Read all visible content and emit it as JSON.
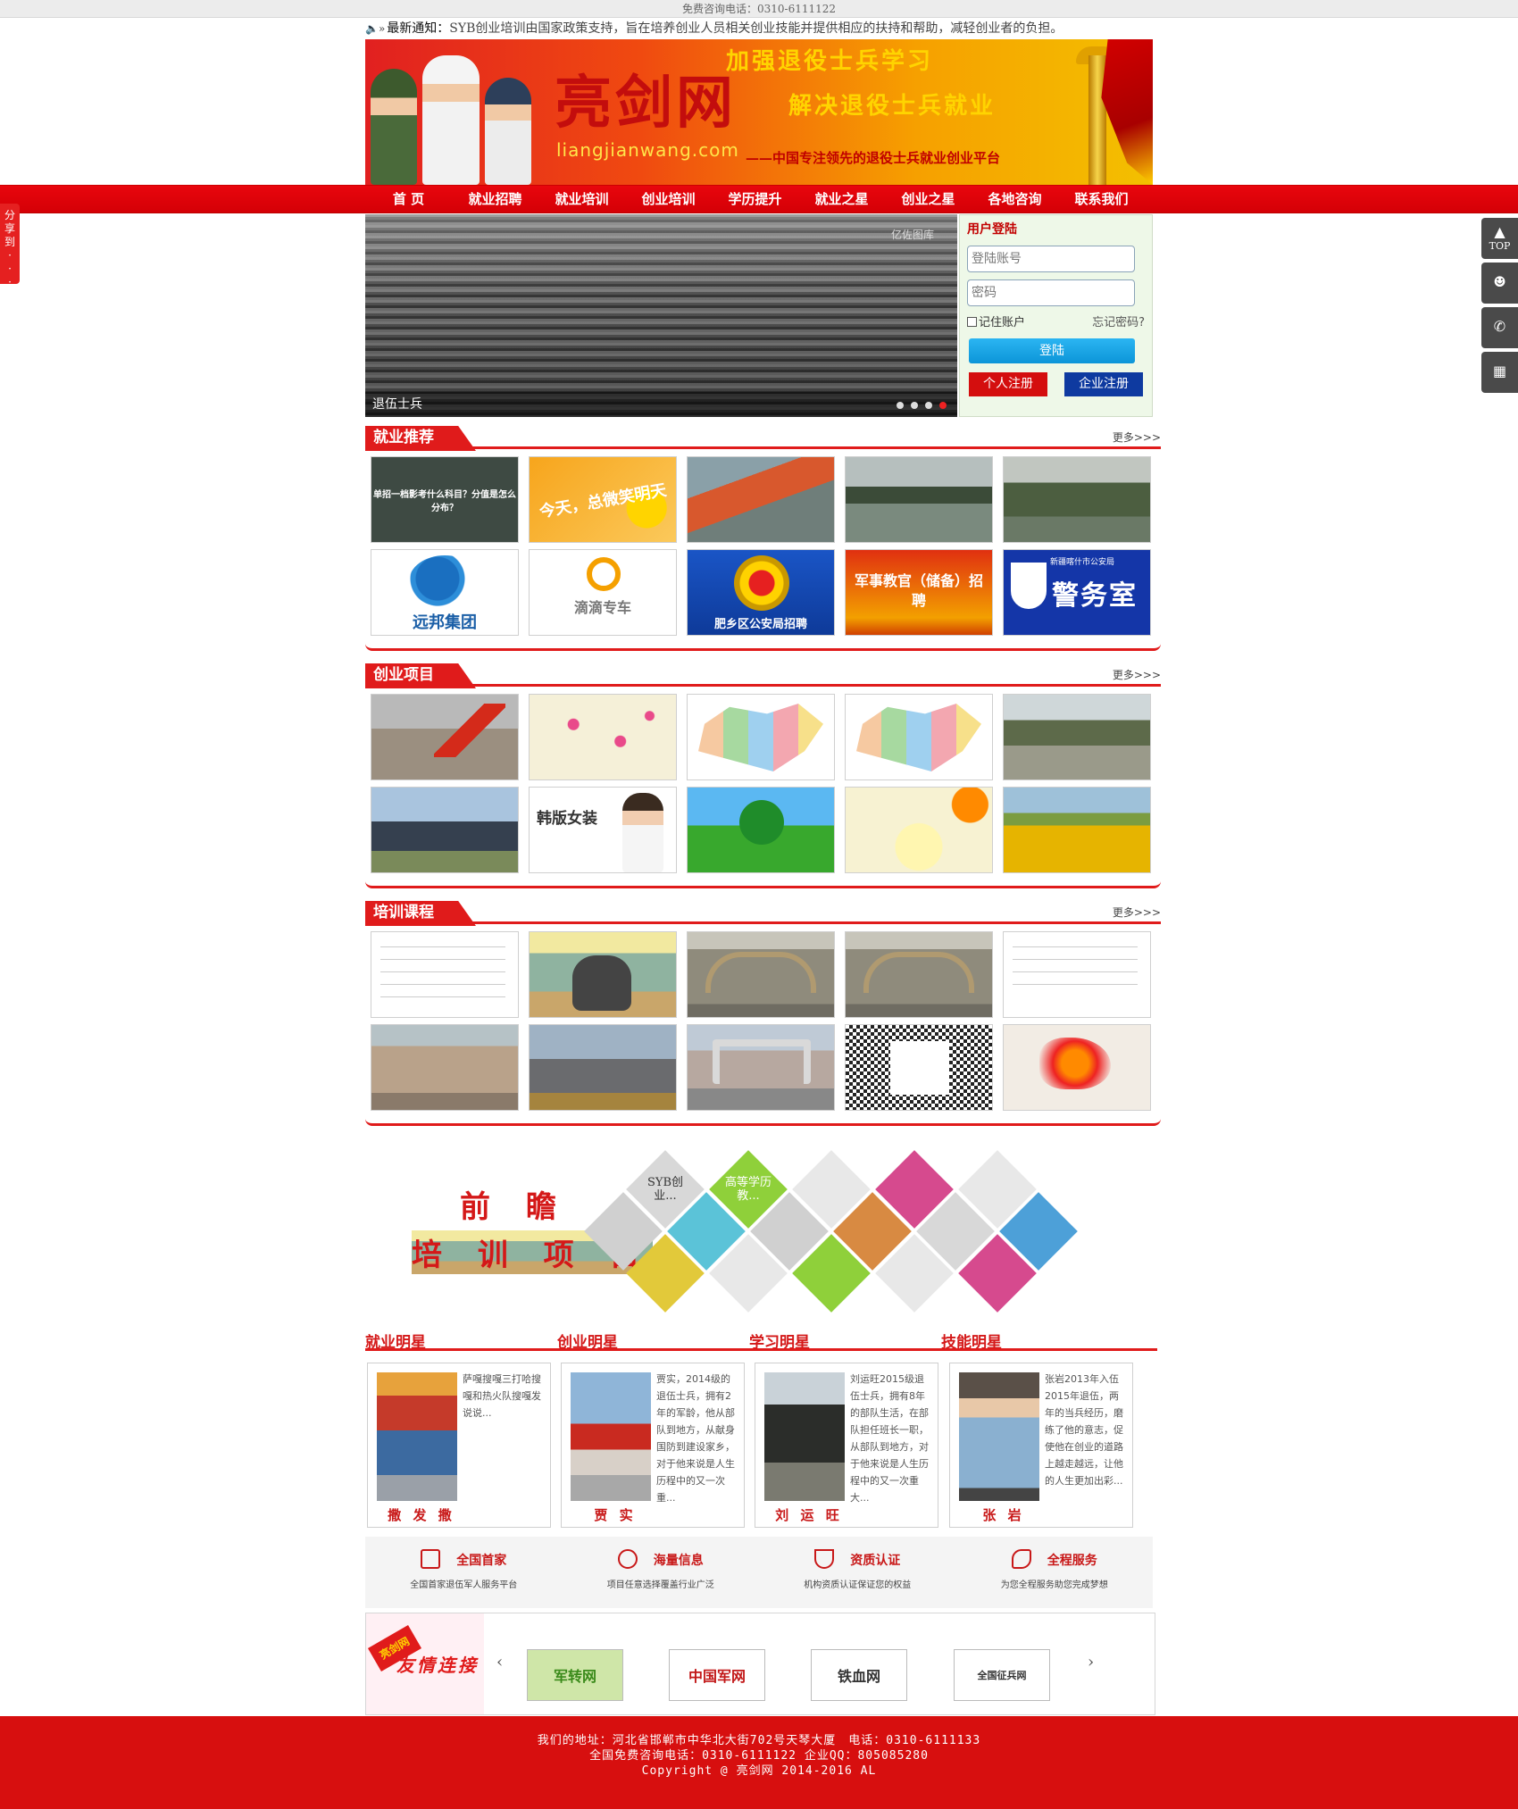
{
  "topbar": {
    "hotline": "免费咨询电话：0310-6111122"
  },
  "notice": {
    "label": "最新通知：",
    "text": "SYB创业培训由国家政策支持，旨在培养创业人员相关创业技能并提供相应的扶持和帮助，减轻创业者的负担。"
  },
  "banner": {
    "logo": "亮剑网",
    "logo_en": "liangjianwang.com",
    "slogan1": "加强退役士兵学习",
    "slogan2": "解决退役士兵就业",
    "slogan3": "——中国专注领先的退役士兵就业创业平台"
  },
  "nav": [
    "首 页",
    "就业招聘",
    "就业培训",
    "创业培训",
    "学历提升",
    "就业之星",
    "创业之星",
    "各地咨询",
    "联系我们"
  ],
  "share": {
    "label": [
      "分",
      "享",
      "到",
      "·",
      "·",
      "·"
    ]
  },
  "side_buttons": [
    {
      "icon": "arrow-up-icon",
      "glyph": "▲",
      "label": "TOP"
    },
    {
      "icon": "qq-icon",
      "glyph": "☻",
      "label": ""
    },
    {
      "icon": "phone-icon",
      "glyph": "✆",
      "label": ""
    },
    {
      "icon": "qrcode-icon",
      "glyph": "▦",
      "label": ""
    }
  ],
  "slider": {
    "caption": "退伍士兵",
    "watermark": "亿佐图库",
    "dots": 4,
    "active_dot": 4
  },
  "login": {
    "title": "用户登陆",
    "account_placeholder": "登陆账号",
    "password_placeholder": "密码",
    "remember": "记住账户",
    "forgot": "忘记密码?",
    "submit": "登陆",
    "personal_register": "个人注册",
    "company_register": "企业注册"
  },
  "sections": {
    "jobs": {
      "title": "就业推荐",
      "more": "更多>>>",
      "tiles": {
        "j1": "单招一档影考什么科目？分值是怎么分布？",
        "j2": "今天，总微笑明天",
        "j6": "远邦集团",
        "j7": "滴滴专车",
        "j8": "肥乡区公安局招聘",
        "j9": "军事教官（储备）招 聘",
        "j10": "警务室",
        "j10_top": "新疆喀什市公安局"
      }
    },
    "startup": {
      "title": "创业项目",
      "more": "更多>>>",
      "tiles": {
        "c7": "韩版女装"
      }
    },
    "training": {
      "title": "培训课程",
      "more": "更多>>>"
    }
  },
  "promo": {
    "line1": "前 瞻",
    "line2": "培 训 项 目",
    "diamond1": "SYB创业...",
    "diamond2": "高等学历教..."
  },
  "stars": {
    "headings": [
      "就业明星",
      "创业明星",
      "学习明星",
      "技能明星"
    ],
    "cards": [
      {
        "name": "撒 发 撒",
        "text": "萨嘎搜嘎三打哈搜嘎和热火队搜嘎发说说..."
      },
      {
        "name": "贾 实",
        "text": "贾实，2014级的退伍士兵，拥有2年的军龄，他从部队到地方，从献身国防到建设家乡，对于他来说是人生历程中的又一次重..."
      },
      {
        "name": "刘 运 旺",
        "text": "刘运旺2015级退伍士兵，拥有8年的部队生活，在部队担任班长一职，从部队到地方，对于他来说是人生历程中的又一次重大..."
      },
      {
        "name": "张 岩",
        "text": "张岩2013年入伍2015年退伍，两年的当兵经历，磨练了他的意志，促使他在创业的道路上越走越远，让他的人生更加出彩..."
      }
    ]
  },
  "features": [
    {
      "icon": "book-icon",
      "title": "全国首家",
      "desc": "全国首家退伍军人服务平台"
    },
    {
      "icon": "magnifier-icon",
      "title": "海量信息",
      "desc": "项目任意选择覆盖行业广泛"
    },
    {
      "icon": "shield-icon",
      "title": "资质认证",
      "desc": "机构资质认证保证您的权益"
    },
    {
      "icon": "service-icon",
      "title": "全程服务",
      "desc": "为您全程服务助您完成梦想"
    }
  ],
  "friend_links": {
    "stamp": "亮剑网",
    "title": "友情连接",
    "prev": "‹",
    "next": "›",
    "items": [
      "军转网",
      "中国军网",
      "铁血网",
      "全国征兵网"
    ]
  },
  "footer": {
    "address": "我们的地址：河北省邯郸市中华北大街702号天琴大厦　电话：0310-6111133",
    "hotline": "全国免费咨询电话：0310-6111122 企业QQ：805085280",
    "copyright": "Copyright @ 亮剑网 2014-2016 AL"
  }
}
